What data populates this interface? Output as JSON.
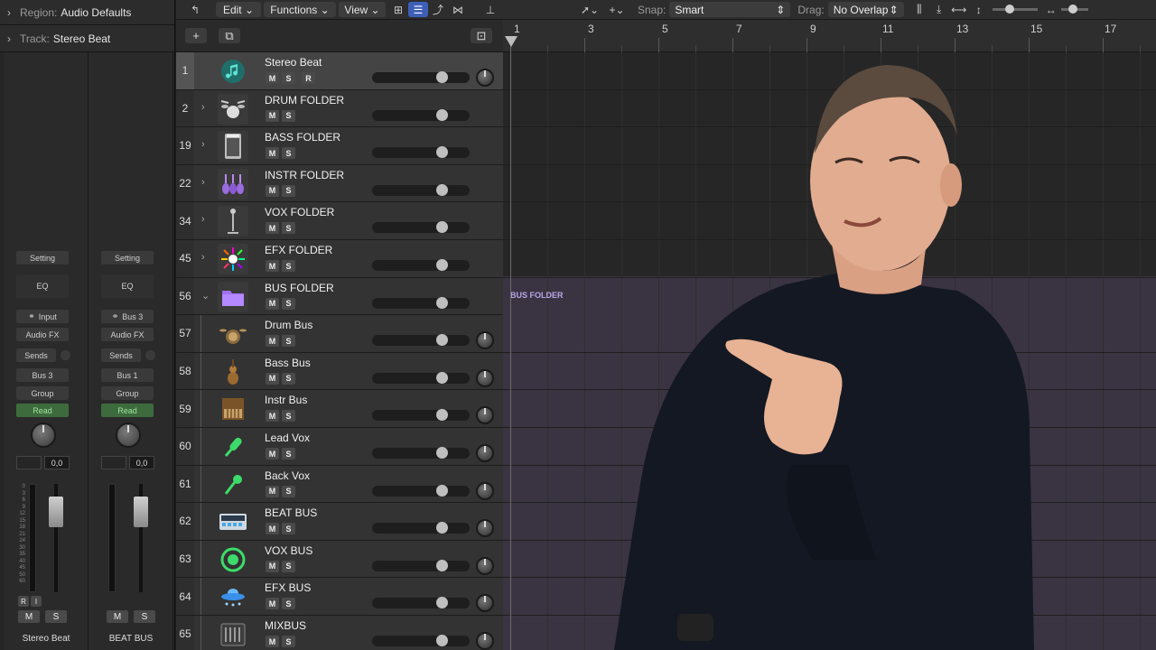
{
  "inspector": {
    "region_label": "Region:",
    "region_value": "Audio Defaults",
    "track_label": "Track:",
    "track_value": "Stereo Beat",
    "strips": [
      {
        "setting": "Setting",
        "eq": "EQ",
        "input": "Input",
        "audio_fx": "Audio FX",
        "sends": "Sends",
        "output": "Bus 3",
        "group": "Group",
        "automation": "Read",
        "value": "0,0",
        "mute": "M",
        "solo": "S",
        "rec": "R",
        "input_mon": "I",
        "name": "Stereo Beat"
      },
      {
        "setting": "Setting",
        "eq": "EQ",
        "input": "Bus 3",
        "audio_fx": "Audio FX",
        "sends": "Sends",
        "output": "Bus 1",
        "group": "Group",
        "automation": "Read",
        "value": "0,0",
        "mute": "M",
        "solo": "S",
        "name": "BEAT BUS"
      }
    ],
    "meter_scale": [
      "0",
      "3",
      "6",
      "9",
      "12",
      "15",
      "18",
      "21",
      "24",
      "30",
      "35",
      "40",
      "45",
      "50",
      "60"
    ]
  },
  "toolbar": {
    "edit": "Edit",
    "functions": "Functions",
    "view": "View",
    "snap_label": "Snap:",
    "snap_value": "Smart",
    "drag_label": "Drag:",
    "drag_value": "No Overlap"
  },
  "ruler": {
    "bars": [
      "1",
      "3",
      "5",
      "7",
      "9",
      "11",
      "13",
      "15",
      "17"
    ]
  },
  "tracks": [
    {
      "num": "1",
      "name": "Stereo Beat",
      "icon": "music-note-icon",
      "type": "audio",
      "selected": true,
      "buttons": [
        "M",
        "S",
        "R"
      ]
    },
    {
      "num": "2",
      "name": "DRUM FOLDER",
      "icon": "drum-kit-icon",
      "type": "folder",
      "buttons": [
        "M",
        "S"
      ]
    },
    {
      "num": "19",
      "name": "BASS FOLDER",
      "icon": "amp-icon",
      "type": "folder",
      "buttons": [
        "M",
        "S"
      ]
    },
    {
      "num": "22",
      "name": "INSTR FOLDER",
      "icon": "strings-icon",
      "type": "folder",
      "buttons": [
        "M",
        "S"
      ]
    },
    {
      "num": "34",
      "name": "VOX FOLDER",
      "icon": "mic-stand-icon",
      "type": "folder",
      "buttons": [
        "M",
        "S"
      ]
    },
    {
      "num": "45",
      "name": "EFX FOLDER",
      "icon": "sparkle-icon",
      "type": "folder",
      "buttons": [
        "M",
        "S"
      ]
    },
    {
      "num": "56",
      "name": "BUS FOLDER",
      "icon": "folder-icon",
      "type": "folder-open",
      "buttons": [
        "M",
        "S"
      ]
    },
    {
      "num": "57",
      "name": "Drum Bus",
      "icon": "drum-kit-icon",
      "type": "child",
      "buttons": [
        "M",
        "S"
      ]
    },
    {
      "num": "58",
      "name": "Bass Bus",
      "icon": "violin-icon",
      "type": "child",
      "buttons": [
        "M",
        "S"
      ]
    },
    {
      "num": "59",
      "name": "Instr Bus",
      "icon": "piano-icon",
      "type": "child",
      "buttons": [
        "M",
        "S"
      ]
    },
    {
      "num": "60",
      "name": "Lead Vox",
      "icon": "mic-icon",
      "type": "child",
      "buttons": [
        "M",
        "S"
      ]
    },
    {
      "num": "61",
      "name": "Back Vox",
      "icon": "mic-icon",
      "type": "child",
      "buttons": [
        "M",
        "S"
      ]
    },
    {
      "num": "62",
      "name": "BEAT BUS",
      "icon": "beat-machine-icon",
      "type": "child",
      "buttons": [
        "M",
        "S"
      ]
    },
    {
      "num": "63",
      "name": "VOX BUS",
      "icon": "mic-circle-icon",
      "type": "child",
      "buttons": [
        "M",
        "S"
      ]
    },
    {
      "num": "64",
      "name": "EFX BUS",
      "icon": "ufo-icon",
      "type": "child",
      "buttons": [
        "M",
        "S"
      ]
    },
    {
      "num": "65",
      "name": "MIXBUS",
      "icon": "mixer-icon",
      "type": "child",
      "buttons": [
        "M",
        "S"
      ]
    }
  ],
  "arrange": {
    "bus_folder_label": "BUS FOLDER"
  },
  "colors": {
    "accent": "#3e5fb7",
    "bus_band": "#3a3442",
    "read": "#3d6b3d"
  }
}
